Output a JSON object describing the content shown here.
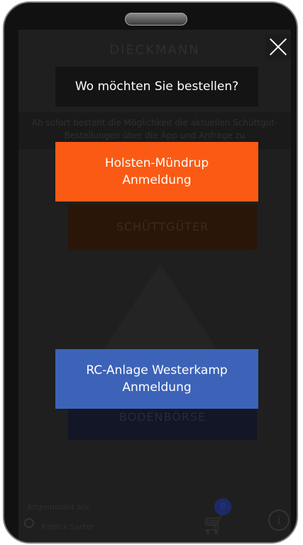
{
  "background": {
    "brand": "DIECKMANN",
    "notice": "Ab sofort besteht die Möglichkeit die aktuellen Schüttgut-Bestellungen über die App und Anfrage zu",
    "cards": [
      "SCHÜTTGÜTER",
      "BODENBÖRSE"
    ],
    "footer": {
      "logged_in_label": "Angemeldet als:",
      "user_name": "Patrick Sartor",
      "cart_count": "0",
      "info_symbol": "i"
    }
  },
  "dialog": {
    "question": "Wo möchten Sie bestellen?",
    "close_symbol": "close",
    "options": [
      {
        "line1": "Holsten-Mündrup",
        "line2": "Anmeldung",
        "color": "#fb5a14"
      },
      {
        "line1": "RC-Anlage Westerkamp",
        "line2": "Anmeldung",
        "color": "#3d63b8"
      }
    ]
  }
}
